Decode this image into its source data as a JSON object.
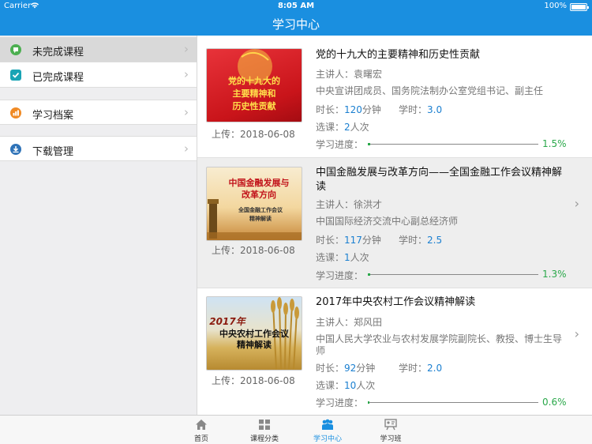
{
  "status": {
    "carrier": "Carrier",
    "time": "8:05 AM",
    "battery": "100%"
  },
  "header": {
    "title": "学习中心"
  },
  "sidebar": {
    "items": [
      {
        "label": "未完成课程",
        "icon": "book-icon",
        "color": "#4caf50",
        "active": true
      },
      {
        "label": "已完成课程",
        "icon": "check-icon",
        "color": "#19a4b5"
      },
      {
        "label": "学习档案",
        "icon": "chart-icon",
        "color": "#f08a24"
      },
      {
        "label": "下载管理",
        "icon": "download-icon",
        "color": "#2f73b8"
      }
    ]
  },
  "courses": [
    {
      "title": "党的十九大的主要精神和历史性贡献",
      "thumb_text": [
        "党的十九大的",
        "主要精神和",
        "历史性贡献"
      ],
      "upload": "上传：2018-06-08",
      "lecturer_label": "主讲人：",
      "lecturer": "袁曙宏",
      "institution": "中央宣讲团成员、国务院法制办公室党组书记、副主任",
      "duration_label": "时长：",
      "duration_value": "120",
      "duration_unit": "分钟",
      "hours_label": "学时：",
      "hours_value": "3.0",
      "enrolled_label": "选课：",
      "enrolled_value": "2",
      "enrolled_unit": "人次",
      "progress_label": "学习进度：",
      "progress_text": "1.5%",
      "progress": 0.015
    },
    {
      "title": "中国金融发展与改革方向——全国金融工作会议精神解读",
      "thumb_text": [
        "中国金融发展与",
        "改革方向",
        "全国金融工作会议",
        "精神解读"
      ],
      "upload": "上传：2018-06-08",
      "lecturer_label": "主讲人：",
      "lecturer": "徐洪才",
      "institution": "中国国际经济交流中心副总经济师",
      "duration_label": "时长：",
      "duration_value": "117",
      "duration_unit": "分钟",
      "hours_label": "学时：",
      "hours_value": "2.5",
      "enrolled_label": "选课：",
      "enrolled_value": "1",
      "enrolled_unit": "人次",
      "progress_label": "学习进度：",
      "progress_text": "1.3%",
      "progress": 0.013
    },
    {
      "title": "2017年中央农村工作会议精神解读",
      "thumb_text": [
        "2017年",
        "中央农村工作会议",
        "精神解读"
      ],
      "upload": "上传：2018-06-08",
      "lecturer_label": "主讲人：",
      "lecturer": "郑风田",
      "institution": "中国人民大学农业与农村发展学院副院长、教授、博士生导师",
      "duration_label": "时长：",
      "duration_value": "92",
      "duration_unit": "分钟",
      "hours_label": "学时：",
      "hours_value": "2.0",
      "enrolled_label": "选课：",
      "enrolled_value": "10",
      "enrolled_unit": "人次",
      "progress_label": "学习进度：",
      "progress_text": "0.6%",
      "progress": 0.006
    }
  ],
  "tabbar": {
    "items": [
      {
        "label": "首页",
        "icon": "home-icon"
      },
      {
        "label": "课程分类",
        "icon": "grid-icon"
      },
      {
        "label": "学习中心",
        "icon": "people-icon",
        "active": true
      },
      {
        "label": "学习班",
        "icon": "class-icon"
      }
    ]
  },
  "colors": {
    "accent": "#1a8fe0",
    "progress": "#2aa84a",
    "value": "#1a7fd0"
  }
}
